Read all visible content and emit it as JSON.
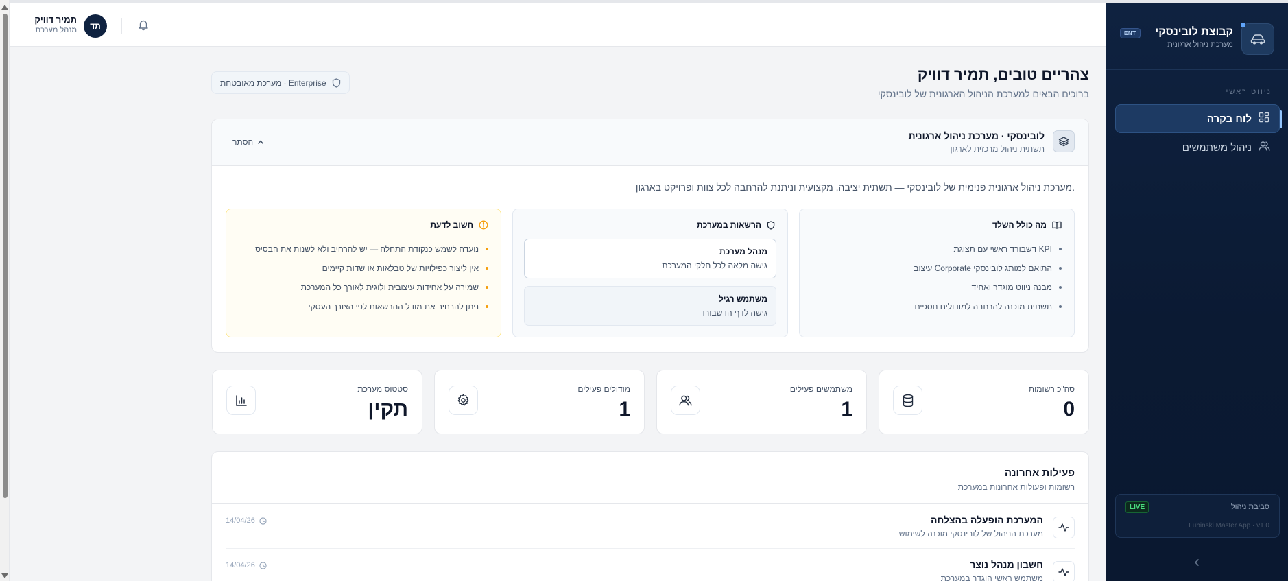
{
  "app": {
    "brand_name": "קבוצת לובינסקי",
    "brand_sub": "מערכת ניהול ארגונית",
    "brand_badge": "ENT"
  },
  "sidebar": {
    "heading": "ניווט ראשי",
    "items": [
      {
        "label": "לוח בקרה",
        "icon": "dashboard-grid-icon",
        "active": true
      },
      {
        "label": "ניהול משתמשים",
        "icon": "users-icon",
        "active": false
      }
    ],
    "env": {
      "title": "סביבת ניהול",
      "badge": "LIVE",
      "version": "Lubinski Master App · v1.0"
    },
    "collapse_icon": "chevron-left-icon"
  },
  "header": {
    "user_initials": "תד",
    "user_name": "תמיר דוויק",
    "user_role": "מנהל מערכת",
    "bell_icon": "bell-icon"
  },
  "main": {
    "greeting": "צהריים טובים, תמיר דוויק",
    "greeting_sub": "ברוכים הבאים למערכת הניהול הארגונית של לובינסקי",
    "secure_pill": "מערכת מאובטחת · Enterprise"
  },
  "info": {
    "title": "לובינסקי · מערכת ניהול ארגונית",
    "subtitle": "תשתית ניהול מרכזית לארגון",
    "hide_label": "הסתר",
    "description": "מערכת ניהול ארגונית פנימית של לובינסקי — תשתית יציבה, מקצועית וניתנת להרחבה לכל צוות ופרויקט בארגון.",
    "includes": {
      "title": "מה כולל השלד",
      "items": [
        "דשבורד ראשי עם תצוגת KPI",
        "עיצוב Corporate התואם למותג לובינסקי",
        "מבנה ניווט מוגדר ואחיד",
        "תשתית מוכנה להרחבה למודולים נוספים"
      ]
    },
    "permissions": {
      "title": "הרשאות במערכת",
      "roles": [
        {
          "title": "מנהל מערכת",
          "desc": "גישה מלאה לכל חלקי המערכת"
        },
        {
          "title": "משתמש רגיל",
          "desc": "גישה לדף הדשבורד"
        }
      ]
    },
    "important": {
      "title": "חשוב לדעת",
      "items": [
        "נועדה לשמש כנקודת התחלה — יש להרחיב ולא לשנות את הבסיס",
        "אין ליצור כפילויות של טבלאות או שדות קיימים",
        "שמירה על אחידות עיצובית ולוגית לאורך כל המערכת",
        "ניתן להרחיב את מודל ההרשאות לפי הצורך העסקי"
      ]
    }
  },
  "stats": [
    {
      "label": "סה\"כ רשומות",
      "value": "0",
      "icon": "database-icon"
    },
    {
      "label": "משתמשים פעילים",
      "value": "1",
      "icon": "users-icon"
    },
    {
      "label": "מודולים פעילים",
      "value": "1",
      "icon": "gear-icon"
    },
    {
      "label": "סטטוס מערכת",
      "value": "תקין",
      "icon": "bar-chart-icon"
    }
  ],
  "activity": {
    "title": "פעילות אחרונה",
    "subtitle": "רשומות ופעולות אחרונות במערכת",
    "rows": [
      {
        "title": "המערכת הופעלה בהצלחה",
        "desc": "מערכת הניהול של לובינסקי מוכנה לשימוש",
        "date": "14/04/26"
      },
      {
        "title": "חשבון מנהל נוצר",
        "desc": "משתמש ראשי הוגדר במערכת",
        "date": "14/04/26"
      }
    ]
  },
  "colors": {
    "sidebar_bg": "#0f2240",
    "accent": "#60a5fa",
    "live": "#4ade80",
    "warning": "#f59e0b"
  }
}
